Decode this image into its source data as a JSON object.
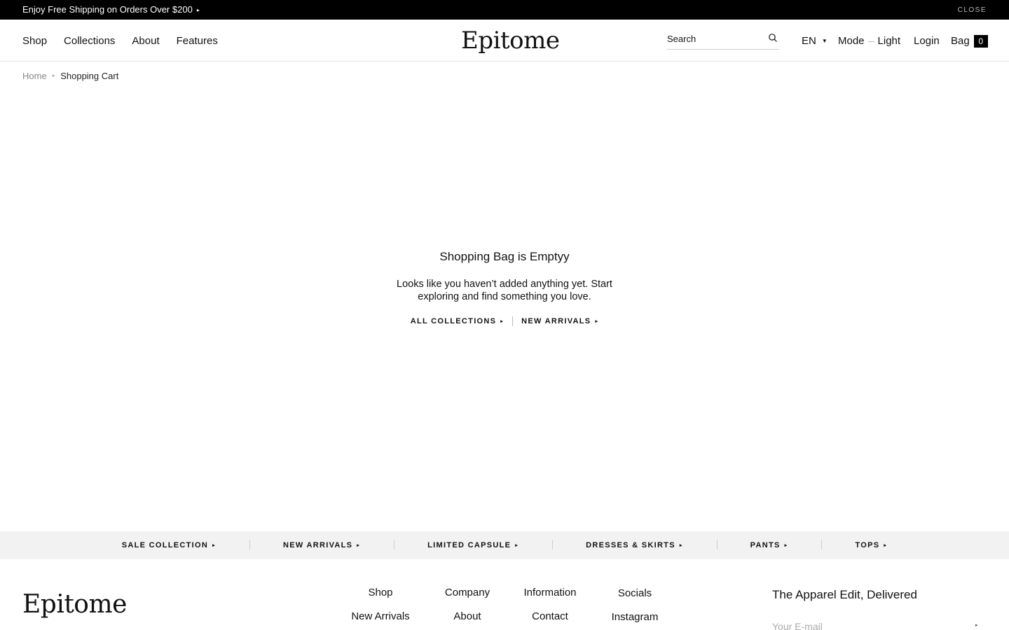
{
  "announcement": {
    "text": "Enjoy Free Shipping on Orders Over $200",
    "close_label": "CLOSE"
  },
  "header": {
    "nav": [
      "Shop",
      "Collections",
      "About",
      "Features"
    ],
    "logo": "Epitome",
    "search": {
      "placeholder": "Search"
    },
    "language": "EN",
    "mode_label": "Mode",
    "mode_value": "Light",
    "login_label": "Login",
    "bag_label": "Bag",
    "bag_count": "0"
  },
  "breadcrumb": {
    "home": "Home",
    "current": "Shopping Cart"
  },
  "empty_state": {
    "title": "Shopping Bag is Emptyy",
    "description": "Looks like you haven’t added anything yet. Start exploring and find something you love.",
    "links": [
      "ALL COLLECTIONS",
      "NEW ARRIVALS"
    ]
  },
  "category_bar": [
    "SALE COLLECTION",
    "NEW ARRIVALS",
    "LIMITED CAPSULE",
    "DRESSES & SKIRTS",
    "PANTS",
    "TOPS"
  ],
  "footer": {
    "logo": "Epitome",
    "columns": [
      {
        "heading": "Shop",
        "link": "New Arrivals"
      },
      {
        "heading": "Company",
        "link": "About"
      },
      {
        "heading": "Information",
        "link": "Contact"
      },
      {
        "heading": "Socials",
        "link": "Instagram"
      }
    ],
    "newsletter": {
      "title": "The Apparel Edit, Delivered",
      "placeholder": "Your E-mail"
    }
  },
  "icons": {
    "search": "search-icon",
    "arrow": "arrow-right-icon",
    "caret": "caret-down-icon"
  }
}
